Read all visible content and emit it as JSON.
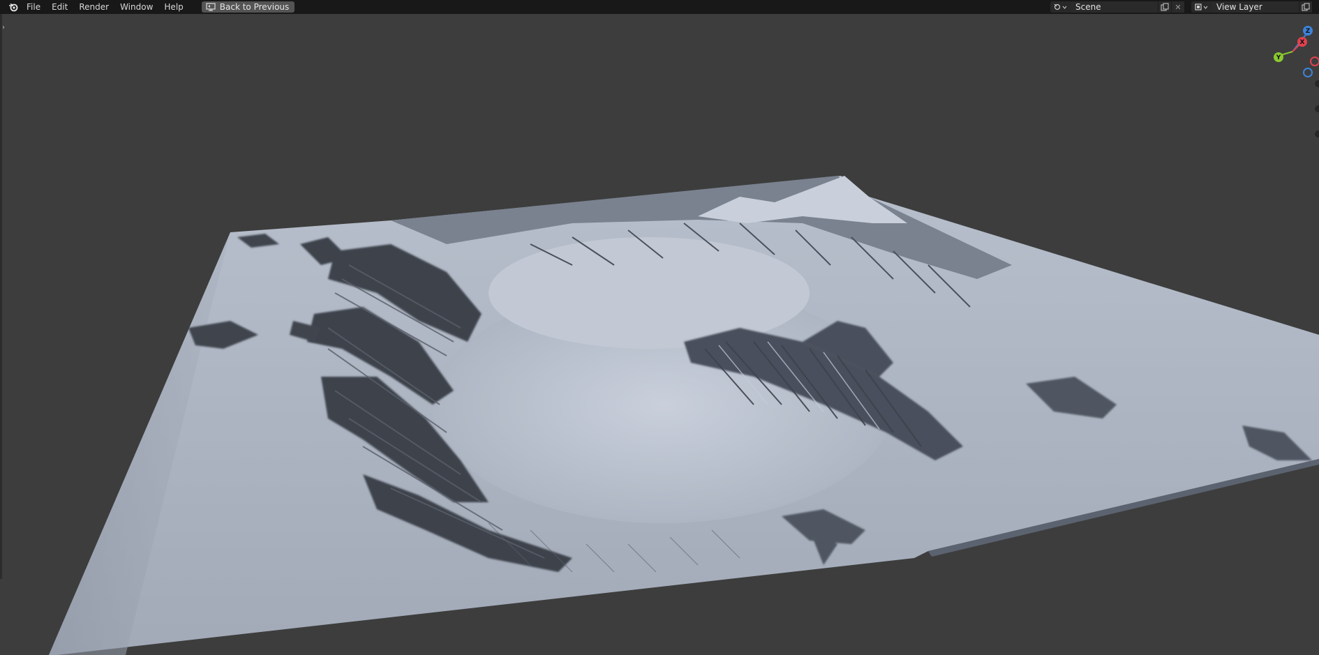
{
  "app": {
    "menu": [
      "File",
      "Edit",
      "Render",
      "Window",
      "Help"
    ],
    "back_button": "Back to Previous"
  },
  "header_right": {
    "scene_name": "Scene",
    "view_layer_name": "View Layer"
  },
  "gizmo": {
    "axes": [
      "Z",
      "X",
      "Y"
    ],
    "colors": {
      "x": "#e0424f",
      "y": "#8ac832",
      "z": "#3d83d8"
    }
  },
  "viewport": {
    "background": "#3d3d3d",
    "terrain_color": "#a6aebc"
  }
}
